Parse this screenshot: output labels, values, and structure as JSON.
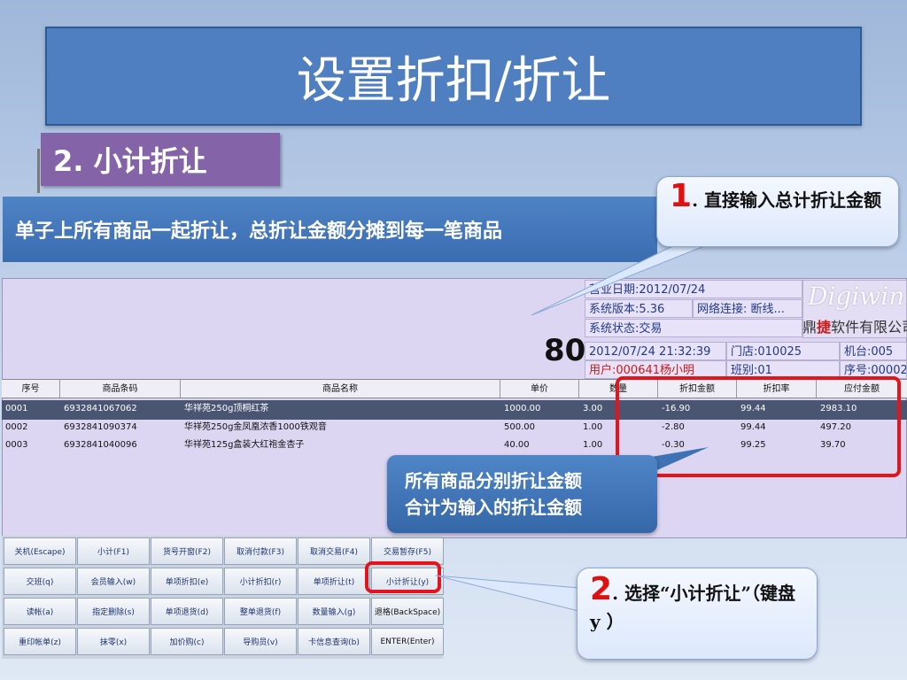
{
  "slide": {
    "title": "设置折扣/折让",
    "section": "2. 小计折让",
    "description": "单子上所有商品一起折让，总折让金额分摊到每一笔商品"
  },
  "callouts": {
    "c1_num": "1",
    "c1_text": ". 直接输入总计折让金额",
    "c2_num": "2",
    "c2_text": ". 选择“小计折让”（键盘 y ）",
    "middle_line1": "所有商品分别折让金额",
    "middle_line2": "合计为输入的折让金额"
  },
  "pos": {
    "total": "80",
    "info": {
      "business_date": "营业日期:2012/07/24",
      "version": "系统版本:5.36",
      "network": "网络连接: 断线...",
      "status": "系统状态:交易",
      "datetime": "2012/07/24 21:32:39",
      "store": "门店:010025",
      "terminal": "机台:005",
      "user": "用户:000641杨小明",
      "shift": "班别:01",
      "serial": "序号:00002"
    },
    "brand": {
      "logo": "Digiwin",
      "name_pre": "鼎",
      "name_red": "捷",
      "name_post": "软件有限公司"
    },
    "table": {
      "headers": [
        "序号",
        "商品条码",
        "商品名称",
        "单价",
        "数量",
        "折扣金额",
        "折扣率",
        "应付金额"
      ],
      "rows": [
        [
          "0001",
          "6932841067062",
          "华祥苑250g顶桐红茶",
          "1000.00",
          "3.00",
          "-16.90",
          "99.44",
          "2983.10"
        ],
        [
          "0002",
          "6932841090374",
          "华祥苑250g金凤凰浓香1000铁观音",
          "500.00",
          "1.00",
          "-2.80",
          "99.44",
          "497.20"
        ],
        [
          "0003",
          "6932841040096",
          "华祥苑125g盒装大红袍金杏子",
          "40.00",
          "1.00",
          "-0.30",
          "99.25",
          "39.70"
        ]
      ]
    },
    "keys": [
      [
        "关机(Escape)",
        "小计(F1)",
        "货号开窗(F2)",
        "取消付款(F3)",
        "取消交易(F4)",
        "交易暂存(F5)"
      ],
      [
        "交班(q)",
        "会员输入(w)",
        "单项折扣(e)",
        "小计折扣(r)",
        "单项折让(t)",
        "小计折让(y)"
      ],
      [
        "读帐(a)",
        "指定删除(s)",
        "单项退货(d)",
        "整单退货(f)",
        "数量输入(g)",
        "退格(BackSpace)"
      ],
      [
        "重印帐单(z)",
        "抹零(x)",
        "加价购(c)",
        "导购员(v)",
        "卡信息查询(b)",
        "ENTER(Enter)"
      ]
    ]
  },
  "colors": {
    "highlight": "#e4141c",
    "banner_blue": "#4f7fc1",
    "section_purple": "#8563a8"
  }
}
